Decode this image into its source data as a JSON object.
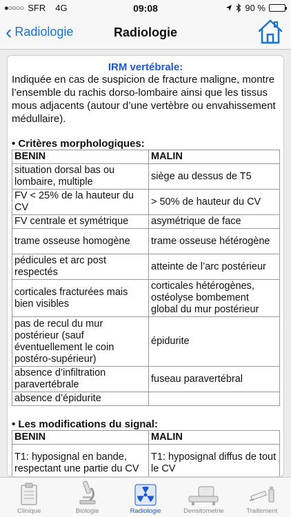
{
  "status": {
    "signal": "●○○○○",
    "carrier": "SFR",
    "network": "4G",
    "time": "09:08",
    "battery_text": "90 %",
    "battery_level": 0.9
  },
  "nav": {
    "back_label": "Radiologie",
    "title": "Radiologie"
  },
  "content": {
    "section_title": "IRM vertébrale:",
    "intro": "Indiquée en cas de suspicion de fracture maligne, montre l’ensemble du rachis dorso-lombaire ainsi que les tissus mous adjacents (autour d’une vertèbre ou envahissement médullaire).",
    "morph": {
      "heading": "• Critères morphologiques:",
      "headers": [
        "BENIN",
        "MALIN"
      ],
      "rows": [
        [
          "situation dorsal bas ou lombaire, multiple",
          "siège au dessus de T5"
        ],
        [
          "FV < 25% de la hauteur du CV",
          "> 50% de hauteur du CV"
        ],
        [
          "FV centrale et symétrique",
          "asymétrique de face"
        ],
        [
          "trame osseuse homogène",
          "trame osseuse hétérogène"
        ],
        [
          "pédicules et arc post respectés",
          "atteinte de l’arc postérieur"
        ],
        [
          "corticales fracturées mais bien visibles",
          "corticales hétérogènes, ostéolyse bombement global du mur postérieur"
        ],
        [
          "pas de recul du mur postérieur (sauf éventuellement le coin postéro-supérieur)",
          "épidurite"
        ],
        [
          "absence d’infiltration paravertébrale",
          "fuseau paravertébral"
        ],
        [
          "absence d’épidurite",
          ""
        ]
      ]
    },
    "signal": {
      "heading": "• Les modifications du signal:",
      "headers": [
        "BENIN",
        "MALIN"
      ],
      "rows": [
        [
          "T1: hyposignal en bande, respectant une partie du CV",
          "T1: hyposignal diffus de tout le CV"
        ]
      ]
    }
  },
  "tabs": [
    {
      "label": "Clinique",
      "icon": "clipboard-icon"
    },
    {
      "label": "Biologie",
      "icon": "microscope-icon"
    },
    {
      "label": "Radiologie",
      "icon": "radiation-icon",
      "active": true
    },
    {
      "label": "Densitometrie",
      "icon": "scanner-icon"
    },
    {
      "label": "Traitement",
      "icon": "syringe-icon"
    }
  ],
  "colors": {
    "accent": "#1a73d9",
    "title_blue": "#1a58d6"
  }
}
